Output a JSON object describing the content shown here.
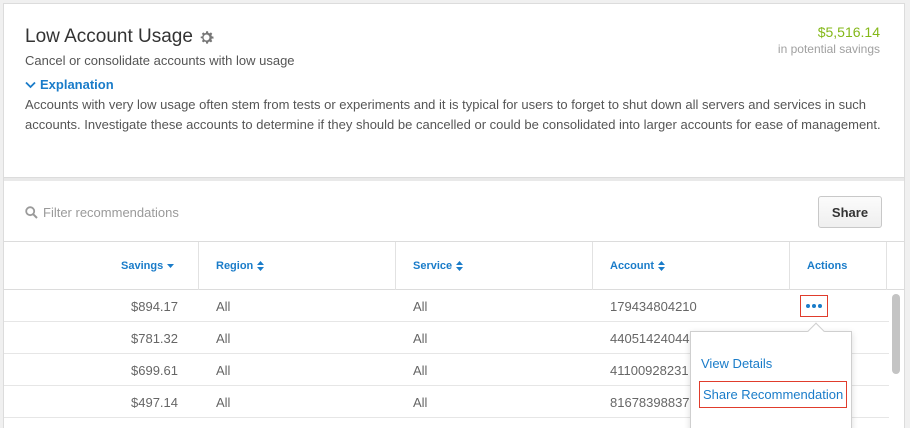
{
  "header": {
    "title": "Low Account Usage",
    "subtitle": "Cancel or consolidate accounts with low usage",
    "savings_amount": "$5,516.14",
    "savings_label": "in potential savings",
    "explanation_toggle": "Explanation",
    "explanation_text": "Accounts with very low usage often stem from tests or experiments and it is typical for users to forget to shut down all servers and services in such accounts. Investigate these accounts to determine if they should be cancelled or could be consolidated into larger accounts for ease of management."
  },
  "filter": {
    "placeholder": "Filter recommendations",
    "share_label": "Share"
  },
  "table": {
    "columns": {
      "savings": "Savings",
      "region": "Region",
      "service": "Service",
      "account": "Account",
      "actions": "Actions"
    },
    "rows": [
      {
        "savings": "$894.17",
        "region": "All",
        "service": "All",
        "account": "179434804210"
      },
      {
        "savings": "$781.32",
        "region": "All",
        "service": "All",
        "account": "44051424044"
      },
      {
        "savings": "$699.61",
        "region": "All",
        "service": "All",
        "account": "41100928231"
      },
      {
        "savings": "$497.14",
        "region": "All",
        "service": "All",
        "account": "81678398837"
      }
    ]
  },
  "menu": {
    "view_details": "View Details",
    "share_recommendation": "Share Recommendation"
  },
  "colors": {
    "accent": "#1a7cc9",
    "savings_green": "#84b819",
    "highlight_red": "#e03c2c"
  }
}
